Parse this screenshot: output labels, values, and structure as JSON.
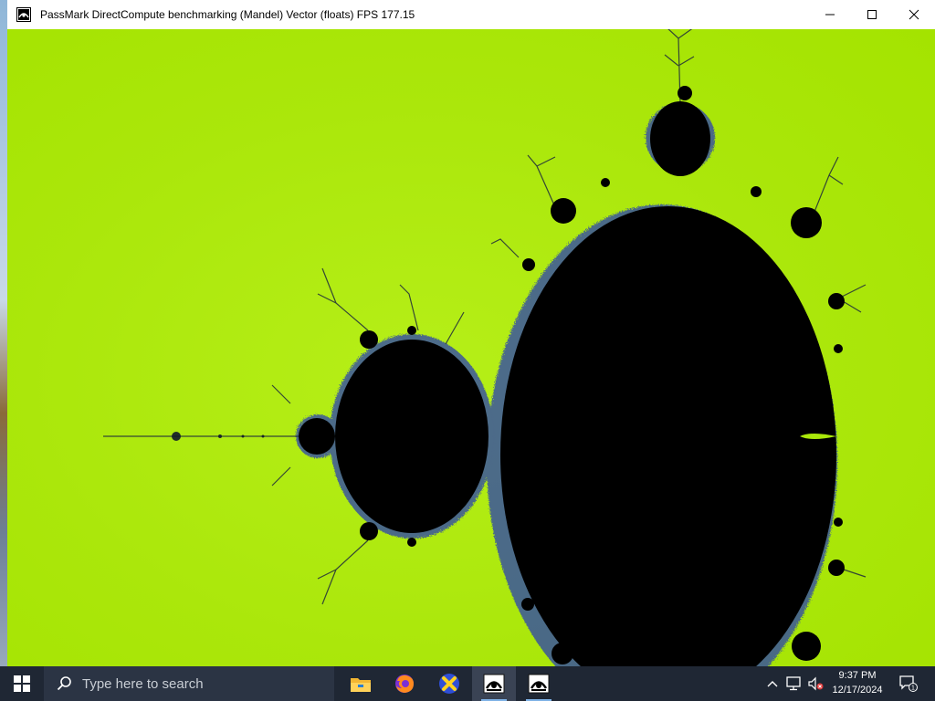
{
  "window": {
    "title": "PassMark DirectCompute benchmarking (Mandel) Vector (floats) FPS 177.15",
    "controls": [
      "minimize-icon",
      "maximize-icon",
      "close-icon"
    ]
  },
  "fractal": {
    "name": "Mandelbrot set",
    "colors": {
      "background": "#aee50a",
      "set": "#000000",
      "edge": "#2a3fb0"
    }
  },
  "taskbar": {
    "search_placeholder": "Type here to search",
    "apps": [
      "file-explorer-icon",
      "firefox-icon",
      "xfinity-icon",
      "passmark-icon",
      "passmark-icon"
    ],
    "clock": {
      "time": "9:37 PM",
      "date": "12/17/2024"
    },
    "notification_count": "1"
  }
}
